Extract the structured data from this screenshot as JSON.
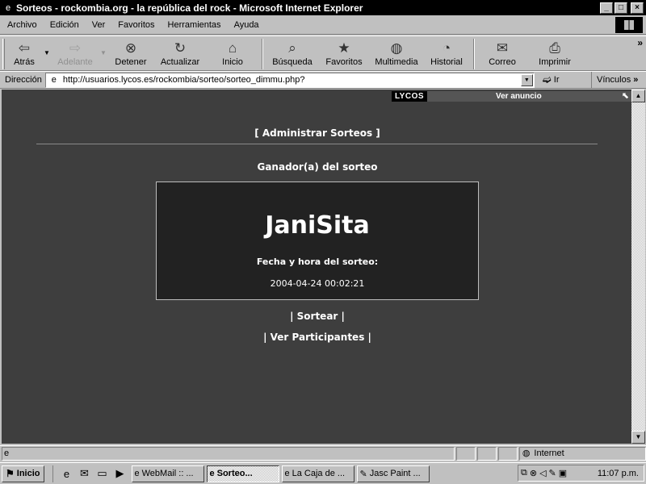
{
  "window": {
    "title": "Sorteos - rockombia.org - la república del rock - Microsoft Internet Explorer",
    "controls": {
      "minimize": "_",
      "maximize": "□",
      "close": "×"
    }
  },
  "menu": [
    {
      "label": "Archivo"
    },
    {
      "label": "Edición"
    },
    {
      "label": "Ver"
    },
    {
      "label": "Favoritos"
    },
    {
      "label": "Herramientas"
    },
    {
      "label": "Ayuda"
    }
  ],
  "toolbar": {
    "back": "Atrás",
    "forward": "Adelante",
    "stop": "Detener",
    "refresh": "Actualizar",
    "home": "Inicio",
    "search": "Búsqueda",
    "favorites": "Favoritos",
    "media": "Multimedia",
    "history": "Historial",
    "mail": "Correo",
    "print": "Imprimir",
    "more": "»"
  },
  "address": {
    "label": "Dirección",
    "url": "http://usuarios.lycos.es/rockombia/sorteo/sorteo_dimmu.php?",
    "go": "Ir",
    "links": "Vínculos",
    "more": "»"
  },
  "lycos": {
    "logo": "LYCOS",
    "ad": "Ver anuncio"
  },
  "page": {
    "admin_link": "[ Administrar Sorteos ]",
    "winner_heading": "Ganador(a) del sorteo",
    "winner_name": "JaniSita",
    "datetime_label": "Fecha y hora del sorteo:",
    "datetime_value": "2004-04-24 00:02:21",
    "draw_link": "| Sortear |",
    "participants_link": "| Ver Participantes |"
  },
  "status": {
    "text": "",
    "zone": "Internet"
  },
  "taskbar": {
    "start": "Inicio",
    "tasks": [
      {
        "label": "WebMail :: ..."
      },
      {
        "label": "Sorteo..."
      },
      {
        "label": "La Caja de ..."
      },
      {
        "label": "Jasc Paint ..."
      }
    ],
    "clock": "11:07 p.m."
  }
}
